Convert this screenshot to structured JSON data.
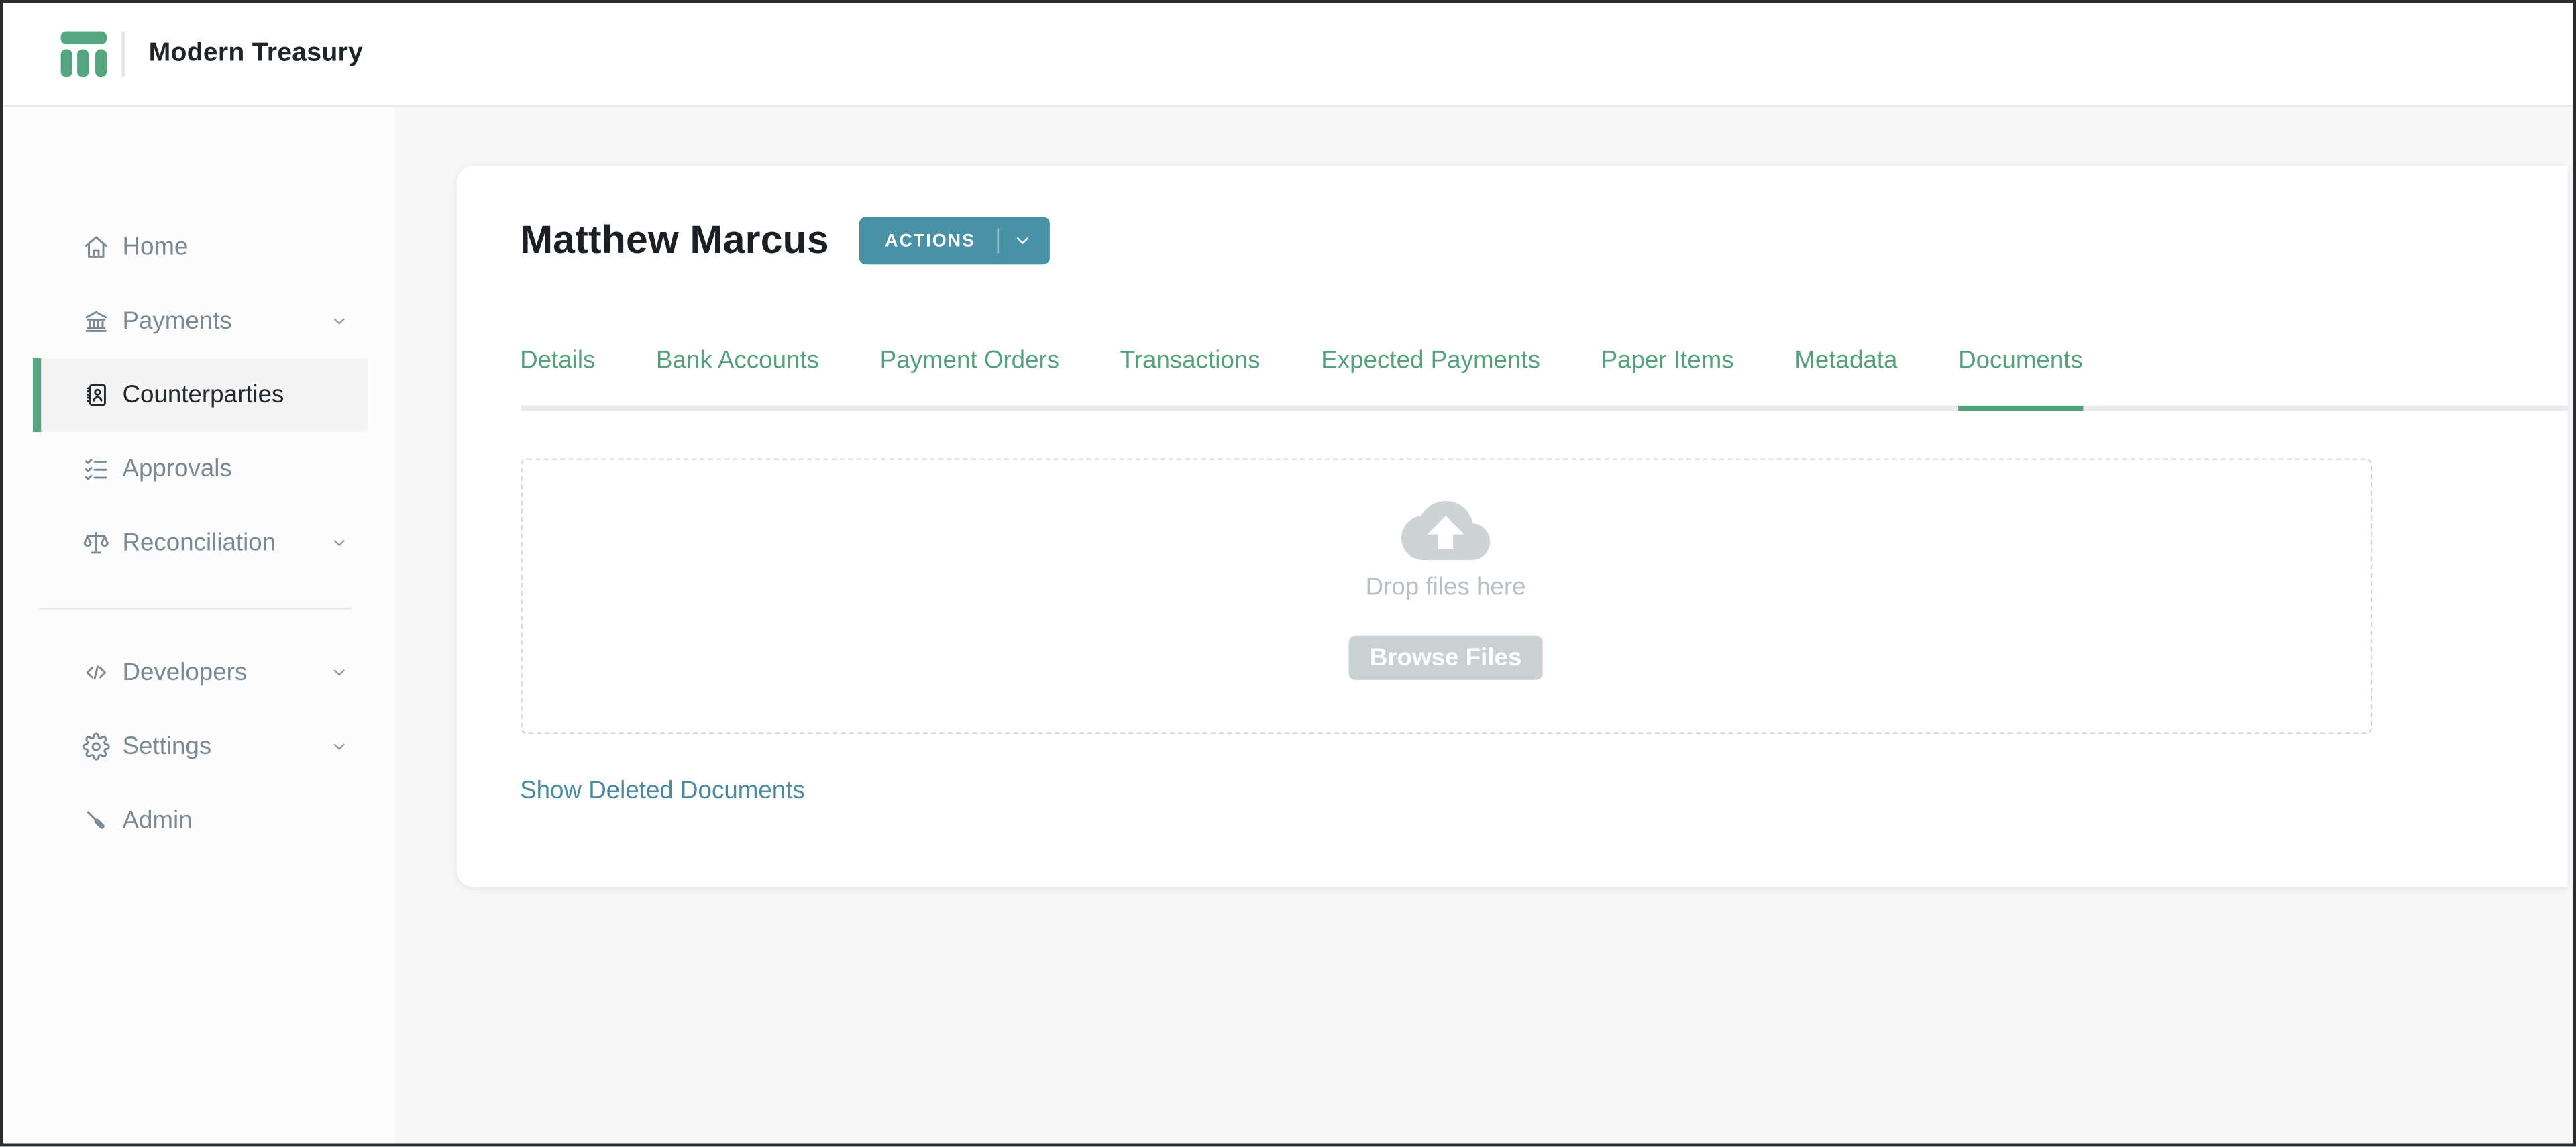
{
  "header": {
    "brand": "Modern Treasury"
  },
  "sidebar": {
    "items": [
      {
        "label": "Home",
        "icon": "home-icon",
        "expandable": false,
        "active": false
      },
      {
        "label": "Payments",
        "icon": "bank-icon",
        "expandable": true,
        "active": false
      },
      {
        "label": "Counterparties",
        "icon": "contact-book-icon",
        "expandable": false,
        "active": true
      },
      {
        "label": "Approvals",
        "icon": "checklist-icon",
        "expandable": false,
        "active": false
      },
      {
        "label": "Reconciliation",
        "icon": "scale-icon",
        "expandable": true,
        "active": false
      },
      {
        "label": "Developers",
        "icon": "code-icon",
        "expandable": true,
        "active": false
      },
      {
        "label": "Settings",
        "icon": "gear-icon",
        "expandable": true,
        "active": false
      },
      {
        "label": "Admin",
        "icon": "screwdriver-icon",
        "expandable": false,
        "active": false
      }
    ]
  },
  "page": {
    "title": "Matthew Marcus",
    "actions_label": "ACTIONS",
    "tabs": [
      "Details",
      "Bank Accounts",
      "Payment Orders",
      "Transactions",
      "Expected Payments",
      "Paper Items",
      "Metadata",
      "Documents"
    ],
    "active_tab": "Documents",
    "dropzone": {
      "drop_text": "Drop files here",
      "browse_label": "Browse Files"
    },
    "show_deleted_link": "Show Deleted Documents"
  },
  "colors": {
    "brand_green": "#55a580",
    "tab_green": "#54a17d",
    "actions_teal": "#4793a5",
    "link_teal": "#4a8aa0",
    "sidebar_text": "#7b8a94",
    "active_nav_text": "#24292e",
    "page_background": "#f7f7f8",
    "drop_text_gray": "#b6c0c5",
    "browse_button_gray": "#cbd0d3",
    "outer_border": "#2b2e31"
  }
}
